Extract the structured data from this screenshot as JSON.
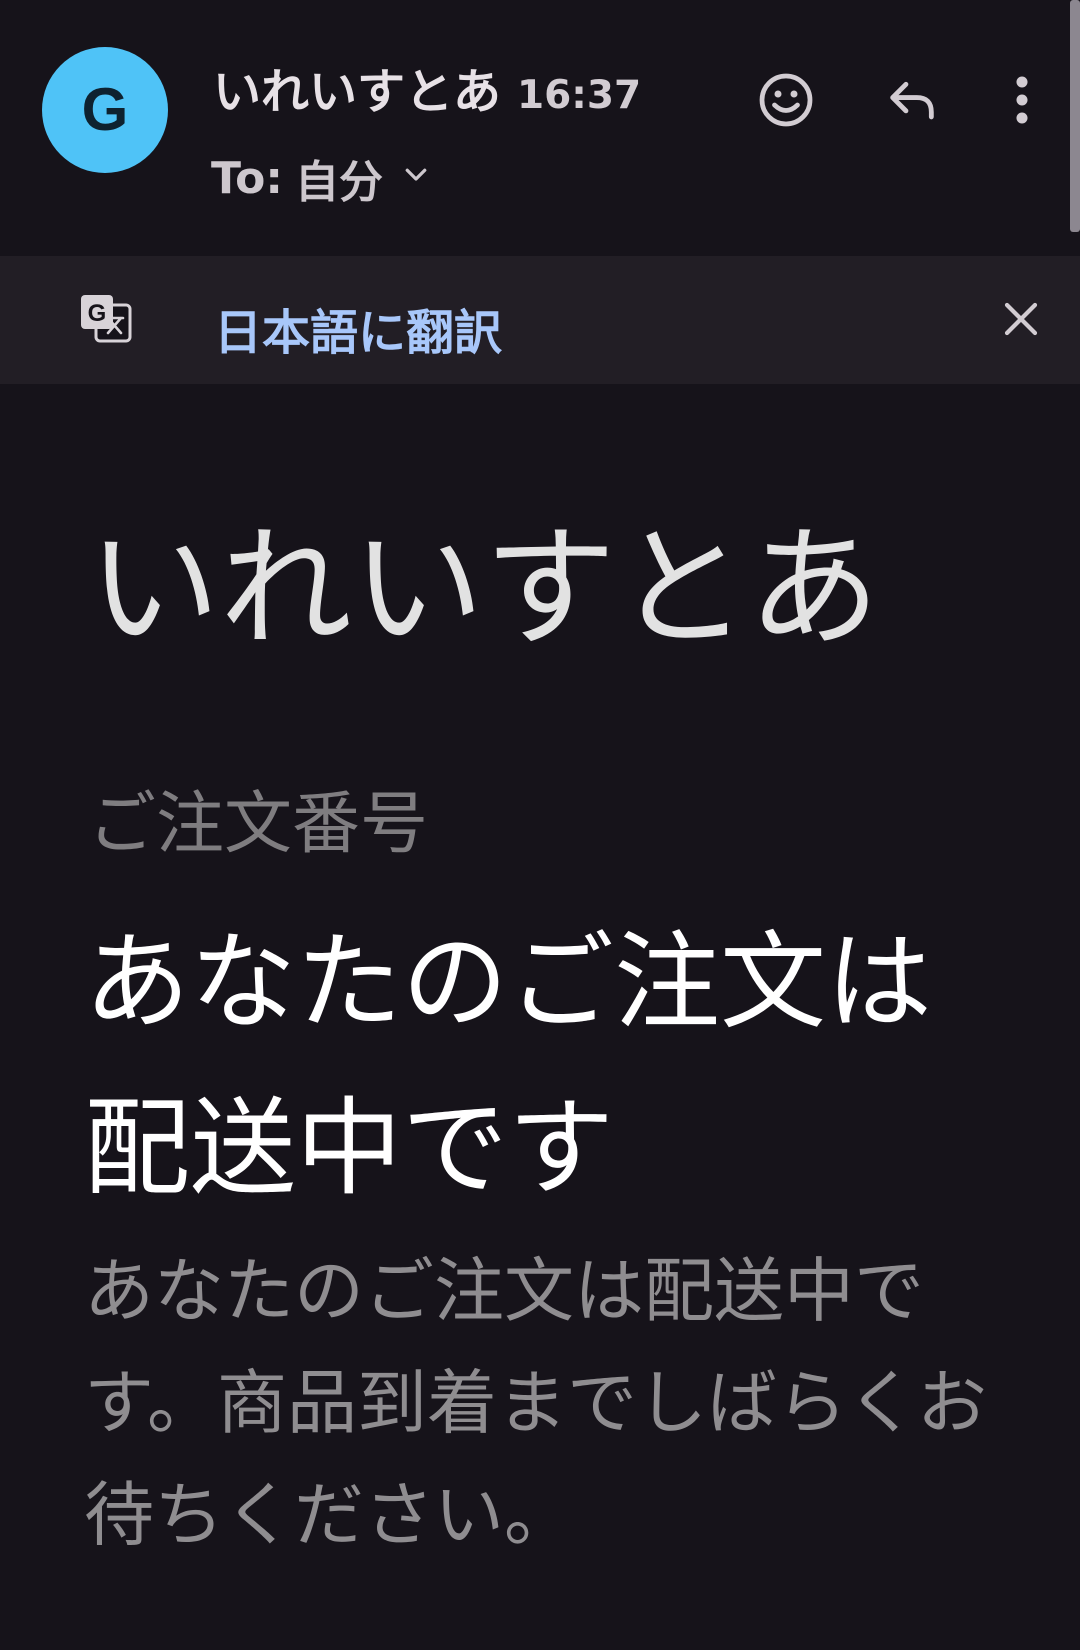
{
  "header": {
    "avatar_letter": "G",
    "sender_name": "いれいすとあ",
    "time": "16:37",
    "recipient_prefix": "To:",
    "recipient": "自分"
  },
  "icons": {
    "avatar": "avatar",
    "recipient_expand": "chevron-down-icon",
    "emoji": "emoji-icon",
    "reply": "reply-icon",
    "more": "more-vert-icon",
    "translate": "translate-icon",
    "close": "close-icon"
  },
  "translate_bar": {
    "link": "日本語に翻訳"
  },
  "email": {
    "brand": "いれいすとあ",
    "order_label": "ご注文番号",
    "headline": "あなたのご注文は配送中です",
    "body": "あなたのご注文は配送中です。商品到着までしばらくお待ちください。"
  },
  "colors": {
    "background": "#16131a",
    "translate_bar": "#221e25",
    "avatar": "#4fc3f7",
    "link": "#a8c7fa"
  }
}
